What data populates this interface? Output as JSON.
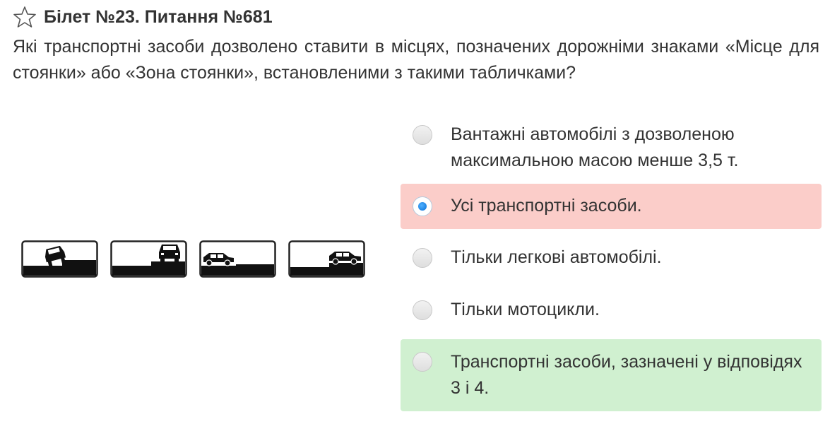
{
  "header": {
    "title": "Білет №23. Питання №681",
    "star_icon": "star-outline-icon"
  },
  "question": {
    "text": "Які транспортні засоби дозволено ставити в місцях, позначених дорожніми знаками «Місце для стоянки» або «Зона стоянки», встановленими з такими табличками?"
  },
  "signs": [
    {
      "name": "sign-plate-parking-on-sidewalk-tilted-car"
    },
    {
      "name": "sign-plate-parking-on-sidewalk-edge-car"
    },
    {
      "name": "sign-plate-parking-on-roadway-side-car"
    },
    {
      "name": "sign-plate-parking-on-sidewalk-side-car"
    }
  ],
  "answers": [
    {
      "text": "Вантажні автомобілі з дозволеною максимальною масою менше 3,5 т.",
      "state": "none",
      "selected": false
    },
    {
      "text": "Усі транспортні засоби.",
      "state": "wrong",
      "selected": true
    },
    {
      "text": "Тільки легкові автомобілі.",
      "state": "none",
      "selected": false
    },
    {
      "text": "Тільки мотоцикли.",
      "state": "none",
      "selected": false
    },
    {
      "text": "Транспортні засоби, зазначені у відповідях 3 і 4.",
      "state": "correct",
      "selected": false
    }
  ],
  "colors": {
    "wrong_bg": "#fbcdc9",
    "correct_bg": "#d0f0d0",
    "radio_selected": "#1e88e5"
  }
}
